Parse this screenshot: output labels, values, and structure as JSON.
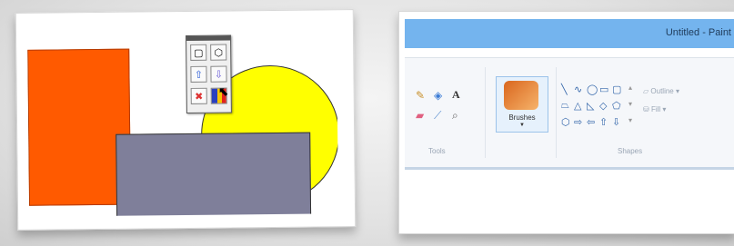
{
  "left_panel": {
    "palette": {
      "icons": [
        "square-shape-icon",
        "hexagon-shape-icon",
        "bring-forward-icon",
        "send-backward-icon",
        "delete-shape-icon",
        "fill-color-icon"
      ]
    },
    "colors": {
      "orange": "#ff5a00",
      "yellow": "#ffff00",
      "slate": "#7f7f9a"
    }
  },
  "right_panel": {
    "window_title": "Untitled - Paint",
    "ribbon": {
      "tools_label": "Tools",
      "brushes_label": "Brushes",
      "shapes_label": "Shapes",
      "outline_label": "Outline",
      "fill_label": "Fill"
    },
    "colors": {
      "titlebar": "#74b4ee"
    }
  }
}
